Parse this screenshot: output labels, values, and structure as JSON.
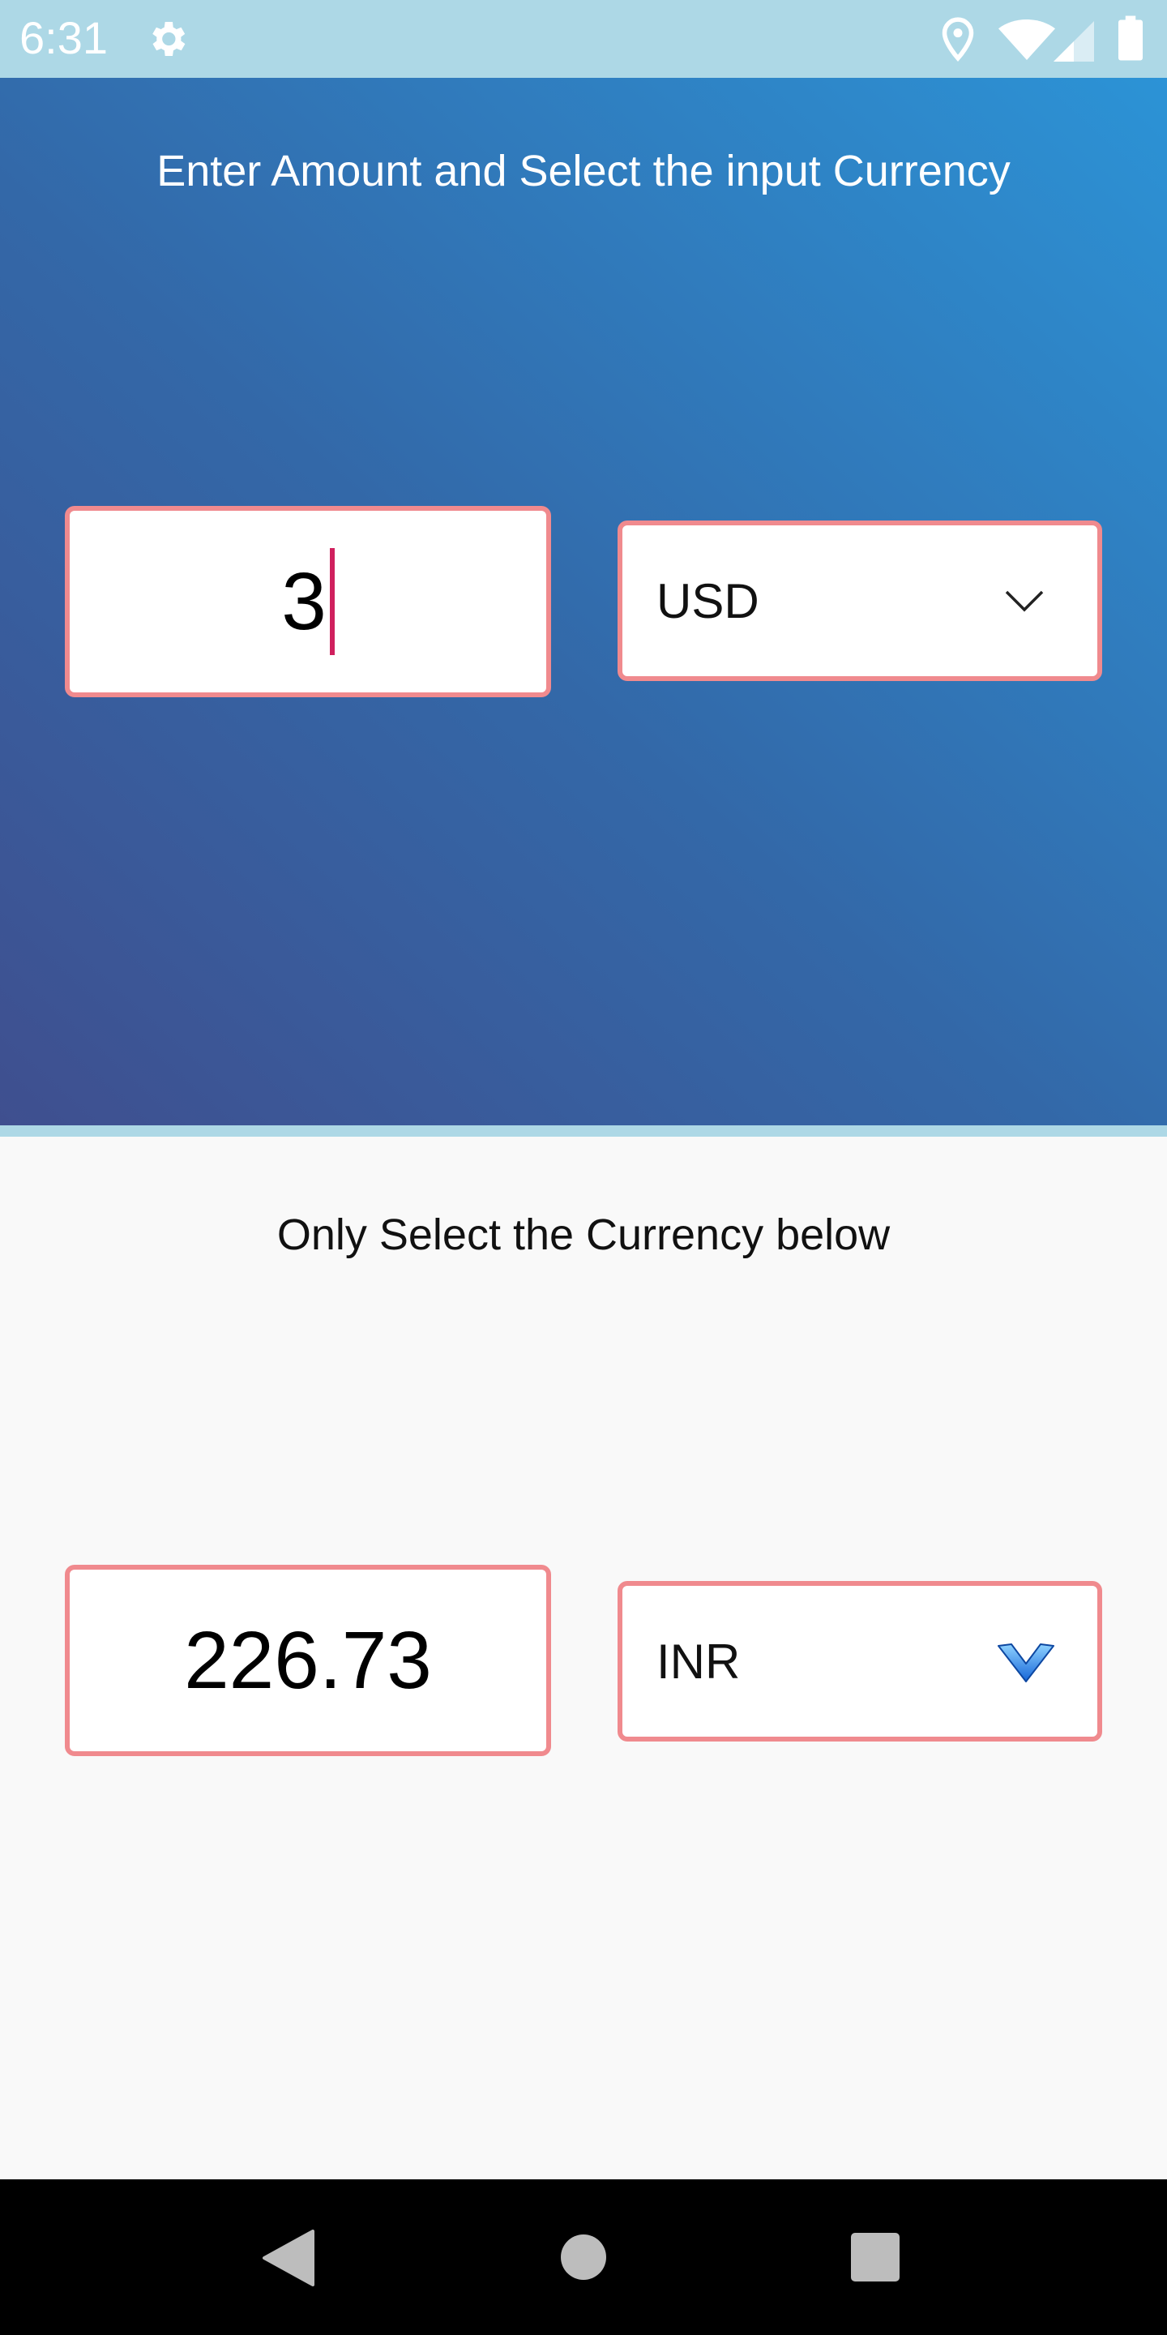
{
  "status_bar": {
    "time": "6:31",
    "icons": [
      "gear-icon",
      "location-icon",
      "wifi-icon",
      "signal-icon",
      "battery-icon"
    ],
    "background": "#add8e6"
  },
  "converter": {
    "input_section": {
      "title": "Enter Amount and Select the input Currency",
      "amount_value": "3",
      "currency": "USD",
      "gradient_colors": [
        "#3f4f8f",
        "#3368a8",
        "#2c93d6"
      ]
    },
    "output_section": {
      "title": "Only Select the Currency below",
      "result_value": "226.73",
      "currency": "INR"
    },
    "border_color": "#f08a8e",
    "caret_color": "#d0205e"
  },
  "nav_bar": {
    "buttons": [
      "back-icon",
      "home-icon",
      "recents-icon"
    ]
  }
}
